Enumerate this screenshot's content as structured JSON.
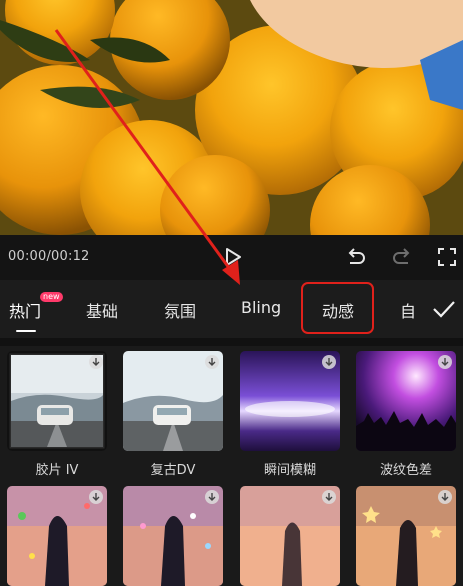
{
  "player": {
    "time": "00:00/00:12"
  },
  "tabs": [
    {
      "label": "热门",
      "badge": "new",
      "active": true
    },
    {
      "label": "基础"
    },
    {
      "label": "氛围"
    },
    {
      "label": "Bling"
    },
    {
      "label": "动感",
      "highlighted": true
    },
    {
      "label": "自"
    }
  ],
  "effects": [
    {
      "label": "胶片 IV"
    },
    {
      "label": "复古DV"
    },
    {
      "label": "瞬间模糊"
    },
    {
      "label": "波纹色差"
    },
    {
      "label": ""
    },
    {
      "label": ""
    },
    {
      "label": ""
    },
    {
      "label": ""
    }
  ],
  "icons": {
    "play": "play-icon",
    "undo": "undo-icon",
    "redo": "redo-icon",
    "fullscreen": "fullscreen-icon",
    "confirm": "checkmark-icon",
    "download": "download-icon"
  },
  "colors": {
    "annotation": "#e0211b",
    "badge": "#ff3a6a",
    "background": "#1a1a1a"
  }
}
